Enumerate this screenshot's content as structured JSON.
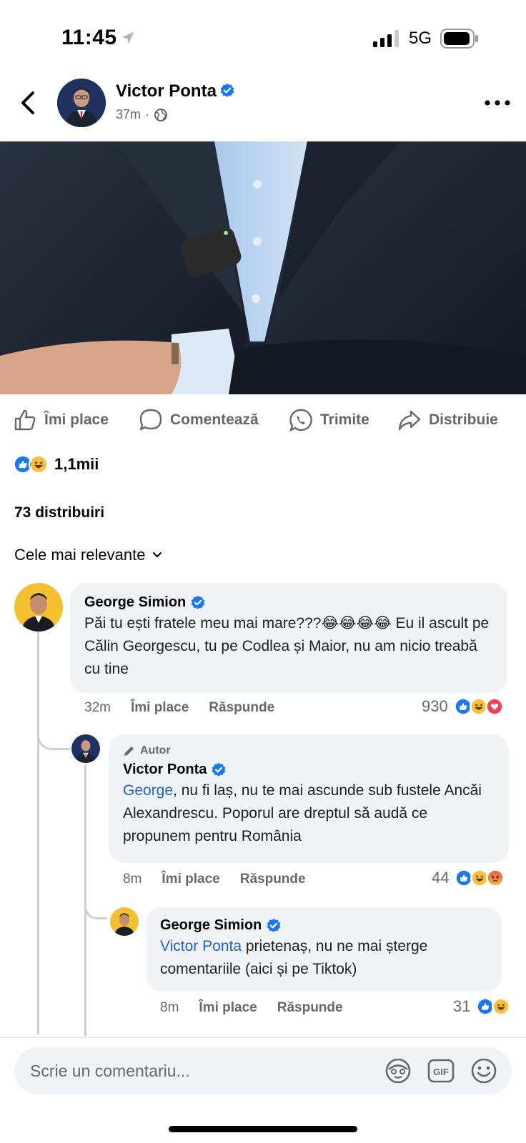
{
  "status": {
    "time": "11:45",
    "network": "5G"
  },
  "post": {
    "author": "Victor Ponta",
    "time": "37m",
    "actions": {
      "like": "Îmi place",
      "comment": "Comentează",
      "send": "Trimite",
      "share": "Distribuie"
    },
    "reaction_count": "1,1mii",
    "shares": "73 distribuiri",
    "sort_label": "Cele mai relevante"
  },
  "comments": [
    {
      "author": "George Simion",
      "text": "Păi tu ești fratele meu mai mare???😂😂😂😂 Eu il ascult pe Călin Georgescu, tu pe Codlea și Maior, nu am nicio treabă cu tine",
      "text_main": "Păi tu ești fratele meu mai mare???",
      "text_emoji": "😂😂😂😂",
      "text_rest": " Eu il ascult pe Călin Georgescu, tu pe Codlea și Maior, nu am nicio treabă cu tine",
      "time": "32m",
      "like": "Îmi place",
      "reply": "Răspunde",
      "reactions": "930"
    },
    {
      "badge": "Autor",
      "author": "Victor Ponta",
      "mention": "George",
      "text": ", nu fi laș, nu te mai ascunde sub fustele Ancăi Alexandrescu. Poporul are dreptul să audă ce propunem pentru România",
      "time": "8m",
      "like": "Îmi place",
      "reply": "Răspunde",
      "reactions": "44"
    },
    {
      "author": "George Simion",
      "mention": "Victor Ponta",
      "text": " prietenaș, nu ne mai șterge comentariile (aici și pe Tiktok)",
      "time": "8m",
      "like": "Îmi place",
      "reply": "Răspunde",
      "reactions": "31"
    }
  ],
  "composer": {
    "placeholder": "Scrie un comentariu..."
  },
  "colors": {
    "accent": "#1877f2",
    "mention": "#1d63c5",
    "bubble": "#f0f2f5",
    "muted": "#65676b"
  },
  "icons": [
    "location-arrow-icon",
    "signal-icon",
    "battery-icon",
    "back-chevron-icon",
    "verified-icon",
    "globe-icon",
    "more-icon",
    "like-icon",
    "comment-icon",
    "whatsapp-icon",
    "share-icon",
    "like-reaction-icon",
    "haha-reaction-icon",
    "love-reaction-icon",
    "angry-reaction-icon",
    "pencil-icon",
    "chevron-down-icon",
    "avatar-sticker-icon",
    "gif-icon",
    "emoji-icon"
  ]
}
